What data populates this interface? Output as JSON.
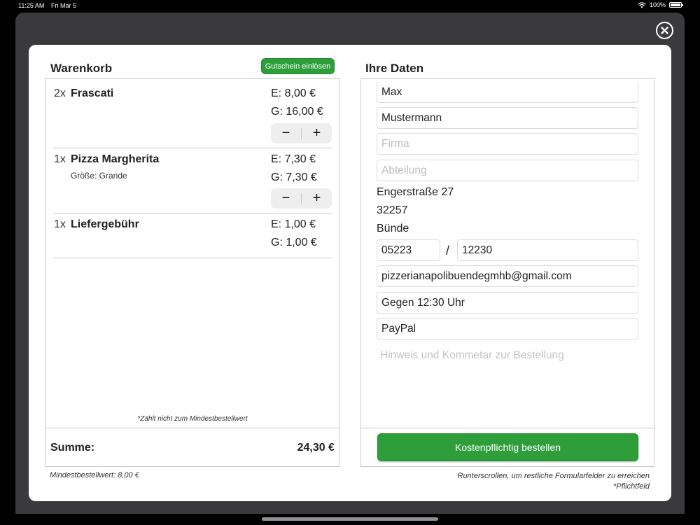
{
  "statusbar": {
    "time": "11:25 AM",
    "date": "Fri Mar 5",
    "battery": "100%"
  },
  "cart": {
    "title": "Warenkorb",
    "voucher_button": "Gutschein einlösen",
    "items": [
      {
        "qty": "2x",
        "name": "Frascati",
        "detail": "",
        "unit_price": "E: 8,00 €",
        "total_price": "G: 16,00 €",
        "decrement": "−",
        "increment": "+"
      },
      {
        "qty": "1x",
        "name": "Pizza Margherita",
        "detail": "Größe: Grande",
        "unit_price": "E: 7,30 €",
        "total_price": "G: 7,30 €",
        "decrement": "−",
        "increment": "+"
      },
      {
        "qty": "1x",
        "name": "Liefergebühr",
        "detail": "",
        "unit_price": "E: 1,00 €",
        "total_price": "G: 1,00 €"
      }
    ],
    "min_order_note": "*Zählt nicht zum Mindestbestellwert",
    "sum_label": "Summe:",
    "sum_value": "24,30 €",
    "min_order_value": "Mindestbestellwert: 8,00 €"
  },
  "customer": {
    "title": "Ihre Daten",
    "first_name": "Max",
    "last_name": "Mustermann",
    "company_placeholder": "Firma",
    "department_placeholder": "Abteilung",
    "street": "Engerstraße 27",
    "zip": "32257",
    "city": "Bünde",
    "phone_area": "05223",
    "phone_separator": "/",
    "phone_number": "12230",
    "email": "pizzerianapolibuendegmhb@gmail.com",
    "delivery_time": "Gegen 12:30 Uhr",
    "payment": "PayPal",
    "comment_placeholder": "Hinweis und Kommetar zur Bestellung",
    "order_button": "Kostenpflichtig bestellen",
    "scroll_hint": "Runterscrollen, um restliche Formularfelder zu erreichen",
    "required_note": "*Pflichtfeld"
  },
  "colors": {
    "accent_green": "#2e9e3b",
    "sheet_bg": "#3a3a3c"
  }
}
